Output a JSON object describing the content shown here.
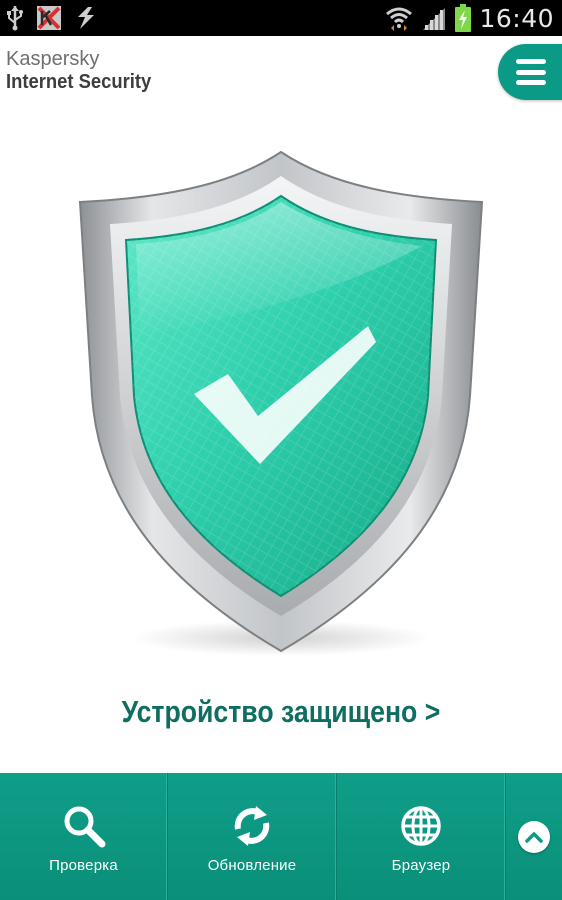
{
  "status_bar": {
    "time": "16:40",
    "left_icons": [
      "usb-icon",
      "kaspersky-notification-icon",
      "sync-icon"
    ],
    "right_icons": [
      "wifi-icon",
      "signal-icon",
      "battery-charging-icon"
    ]
  },
  "header": {
    "brand_line1": "Kaspersky",
    "brand_line2": "Internet Security",
    "menu_icon": "hamburger-menu-icon"
  },
  "main": {
    "status_icon": "protected-shield-icon",
    "status_message": "Устройство защищено >"
  },
  "toolbar": {
    "items": [
      {
        "label": "Проверка",
        "icon": "search-icon"
      },
      {
        "label": "Обновление",
        "icon": "refresh-icon"
      },
      {
        "label": "Браузер",
        "icon": "globe-icon"
      }
    ],
    "expand_icon": "chevron-up-icon"
  },
  "colors": {
    "accent": "#0a9a85",
    "status_text": "#0f6e60",
    "shield_green": "#2fd0ad",
    "status_bar": "#000000"
  }
}
